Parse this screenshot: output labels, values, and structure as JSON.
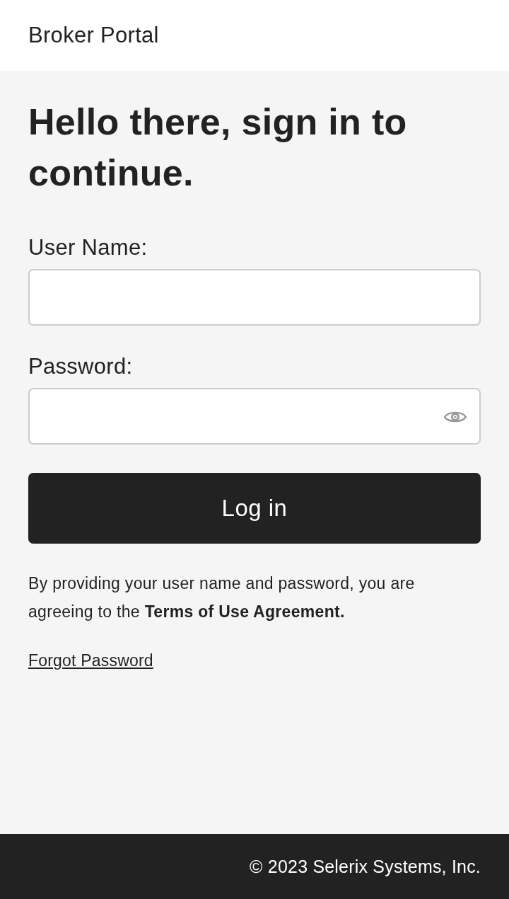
{
  "header": {
    "title": "Broker Portal"
  },
  "heading": "Hello there, sign in to continue.",
  "form": {
    "fields": [
      {
        "label": "User Name:",
        "kind": "text"
      },
      {
        "label": "Password:",
        "kind": "password"
      }
    ],
    "submit": "Log in"
  },
  "notice": "By providing your user name and password, you are agreeing to the **Terms of Use Agreement.**",
  "forgot_link": "Forgot Password",
  "footer": {
    "copyright": "© 2023 Selerix Systems, Inc."
  }
}
